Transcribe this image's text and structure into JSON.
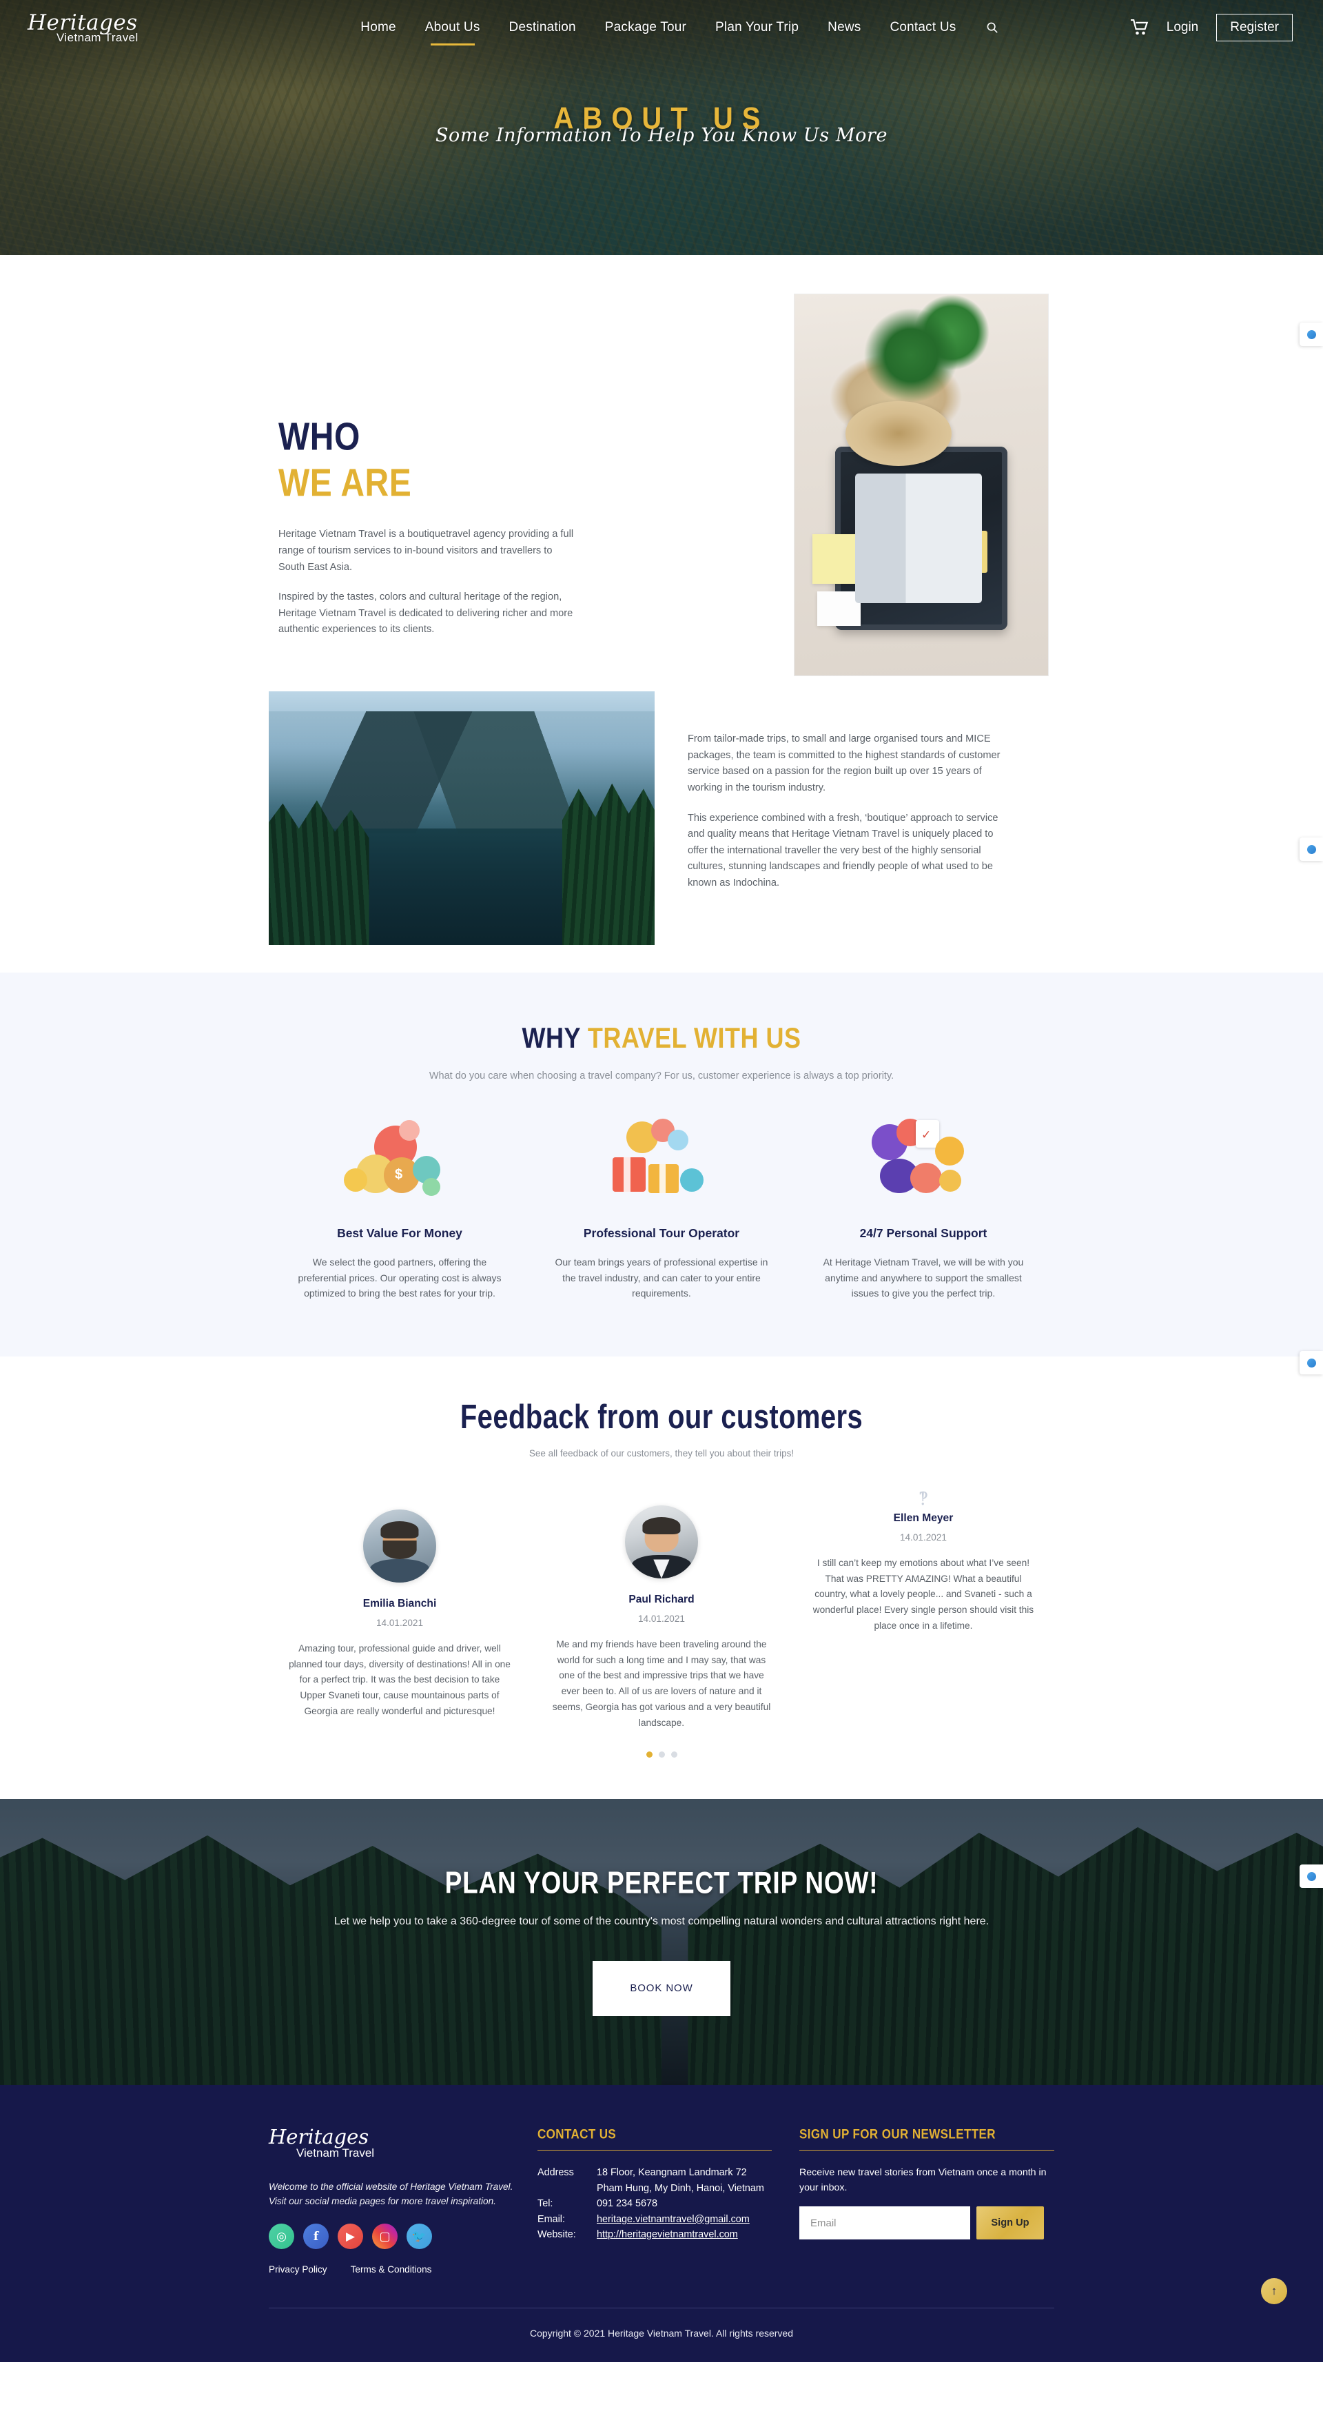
{
  "header": {
    "brand_script": "Heritages",
    "brand_sub": "Vietnam Travel",
    "menu": [
      {
        "label": "Home",
        "active": false
      },
      {
        "label": "About Us",
        "active": true
      },
      {
        "label": "Destination",
        "active": false
      },
      {
        "label": "Package Tour",
        "active": false
      },
      {
        "label": "Plan Your Trip",
        "active": false
      },
      {
        "label": "News",
        "active": false
      },
      {
        "label": "Contact Us",
        "active": false
      }
    ],
    "search_icon": "search-icon",
    "cart_icon": "shopping-cart-icon",
    "login_label": "Login",
    "register_label": "Register"
  },
  "hero": {
    "title": "ABOUT US",
    "subtitle": "Some Information To Help You Know Us More",
    "title_color": "#e7b63a"
  },
  "who_we_are": {
    "heading_line1": "WHO",
    "heading_line2": "WE ARE",
    "paragraph1": "Heritage Vietnam Travel is a boutiquetravel agency providing a full range of tourism services to in-bound visitors and travellers to South East Asia.",
    "paragraph2": "Inspired by the tastes, colors and cultural heritage of the region, Heritage Vietnam Travel is dedicated to delivering richer and more authentic experiences to its clients.",
    "paragraph3": "From tailor-made trips, to small and large organised tours and MICE packages, the team is committed to the highest standards of customer service based on a passion for the region built up over 15 years of working in the tourism industry.",
    "paragraph4": "This experience combined with a fresh, ‘boutique’ approach to service and quality means that Heritage Vietnam Travel is uniquely placed to offer the international traveller the very best of the highly sensorial cultures, stunning landscapes and friendly people of what used to be known as Indochina.",
    "image1_alt": "suitcase-packing-flatlay-image",
    "image2_alt": "mountain-lake-landscape-image"
  },
  "why_travel": {
    "title_dark": "WHY ",
    "title_gold": "TRAVEL WITH US",
    "subtitle": "What do you care when choosing a travel company? For us, customer experience is always a top priority.",
    "cards": [
      {
        "icon": "money-bag-illustration",
        "title": "Best Value For Money",
        "text": "We select the good partners, offering the preferential prices. Our operating cost is always optimized to bring the best rates for your trip."
      },
      {
        "icon": "gift-boxes-illustration",
        "title": "Professional Tour Operator",
        "text": "Our team brings years of professional expertise in the travel industry, and can cater to your entire requirements."
      },
      {
        "icon": "checklist-support-illustration",
        "title": "24/7 Personal Support",
        "text": "At Heritage Vietnam Travel, we will be with you anytime and anywhere to support the smallest issues to give you the perfect trip."
      }
    ]
  },
  "feedback": {
    "title": "Feedback from our customers",
    "subtitle": "See all feedback of our customers, they tell you about their trips!",
    "items": [
      {
        "avatar": "avatar-bearded-man",
        "name": "Emilia Bianchi",
        "date": "14.01.2021",
        "text": "Amazing tour, professional guide and driver, well planned tour days, diversity of destinations! All in one for a perfect trip. It was the best decision to take Upper Svaneti tour, cause mountainous parts of Georgia are really wonderful and picturesque!"
      },
      {
        "avatar": "avatar-man-suit",
        "name": "Paul Richard",
        "date": "14.01.2021",
        "text": "Me and my friends have been traveling around the world for such a long time and I may say, that was one of the best and impressive trips that we have ever been to. All of us are lovers of nature and it seems, Georgia has got various and a very beautiful landscape."
      },
      {
        "avatar": "avatar-placeholder",
        "name": "Ellen Meyer",
        "date": "14.01.2021",
        "text": "I still can’t keep my emotions about what I’ve seen! That was PRETTY AMAZING! What a beautiful country, what a lovely people... and Svaneti - such a wonderful place! Every single person should visit this place once in a lifetime."
      }
    ],
    "carousel_dots": 3,
    "carousel_active_index": 0
  },
  "cta": {
    "title": "PLAN YOUR PERFECT TRIP NOW!",
    "subtitle": "Let we help you to take a 360-degree tour of some of the country's most compelling natural wonders and cultural attractions right here.",
    "button_label": "BOOK NOW"
  },
  "footer": {
    "brand_script": "Heritages",
    "brand_sub": "Vietnam Travel",
    "welcome": "Welcome to the official website of Heritage Vietnam Travel. Visit our social media pages for more travel inspiration.",
    "socials": [
      {
        "name": "tripadvisor-icon",
        "glyph": "◎",
        "class": "tripadvisor"
      },
      {
        "name": "facebook-icon",
        "glyph": "f",
        "class": "facebook"
      },
      {
        "name": "youtube-icon",
        "glyph": "▶",
        "class": "youtube"
      },
      {
        "name": "instagram-icon",
        "glyph": "▢",
        "class": "instagram"
      },
      {
        "name": "twitter-icon",
        "glyph": "ὂ6",
        "class": "twitter"
      }
    ],
    "privacy_label": "Privacy Policy",
    "terms_label": "Terms & Conditions",
    "contact_heading": "CONTACT US",
    "contact": {
      "address_label": "Address",
      "address_line1": "18 Floor, Keangnam Landmark 72",
      "address_line2": "Pham Hung, My Dinh, Hanoi, Vietnam",
      "tel_label": "Tel:",
      "tel_value": "091 234 5678",
      "email_label": "Email:",
      "email_value": "heritage.vietnamtravel@gmail.com",
      "website_label": "Website:",
      "website_value": "http://heritagevietnamtravel.com"
    },
    "newsletter_heading": "SIGN UP FOR OUR NEWSLETTER",
    "newsletter_text": "Receive new travel stories from Vietnam once a month in your inbox.",
    "newsletter_placeholder": "Email",
    "newsletter_value": "",
    "newsletter_button": "Sign Up",
    "copyright": "Copyright © 2021 Heritage Vietnam Travel. All rights reserved",
    "to_top_icon": "arrow-up-icon"
  },
  "side_widgets": [
    {
      "name": "chat-widget-1"
    },
    {
      "name": "chat-widget-2"
    },
    {
      "name": "chat-widget-3"
    },
    {
      "name": "chat-widget-4"
    }
  ]
}
